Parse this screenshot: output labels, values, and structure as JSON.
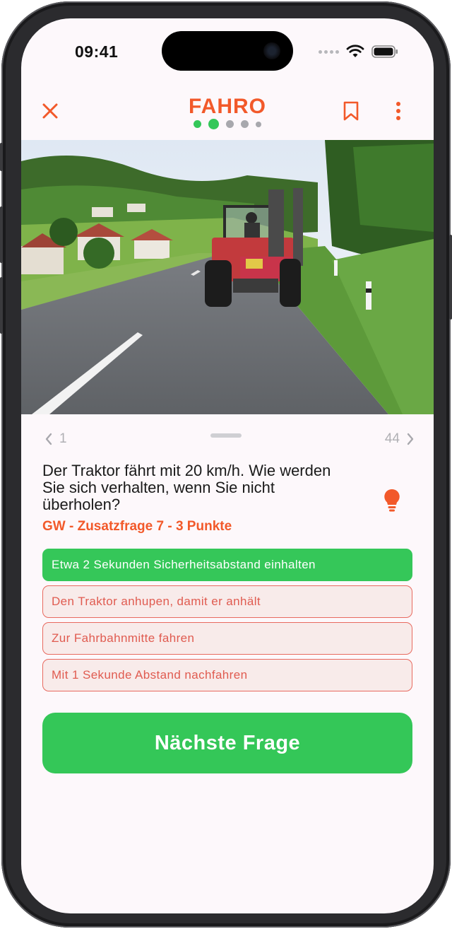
{
  "status_bar": {
    "time": "09:41"
  },
  "header": {
    "logo": "FAHRO",
    "progress_dots": [
      {
        "state": "done",
        "color": "#34c759"
      },
      {
        "state": "current",
        "color": "#34c759"
      },
      {
        "state": "todo",
        "color": "#a8a8ad"
      },
      {
        "state": "todo",
        "color": "#a8a8ad"
      },
      {
        "state": "todo",
        "color": "#a8a8ad"
      }
    ],
    "icons": [
      "close-icon",
      "bookmark-icon",
      "more-vertical-icon"
    ]
  },
  "pager": {
    "prev_number": "1",
    "next_number": "44"
  },
  "question": {
    "text": "Der Traktor fährt mit 20 km/h. Wie werden Sie sich verhalten, wenn Sie nicht überholen?",
    "meta": "GW - Zusatzfrage 7 - 3 Punkte"
  },
  "answers": [
    {
      "label": "Etwa 2 Sekunden Sicherheitsabstand einhalten",
      "state": "correct"
    },
    {
      "label": "Den Traktor anhupen, damit er anhält",
      "state": "wrong"
    },
    {
      "label": "Zur Fahrbahnmitte fahren",
      "state": "wrong"
    },
    {
      "label": "Mit 1 Sekunde Abstand nachfahren",
      "state": "wrong"
    }
  ],
  "next_button": {
    "label": "Nächste Frage"
  },
  "colors": {
    "accent": "#f2592a",
    "success": "#34c759",
    "error": "#e86a5f"
  }
}
